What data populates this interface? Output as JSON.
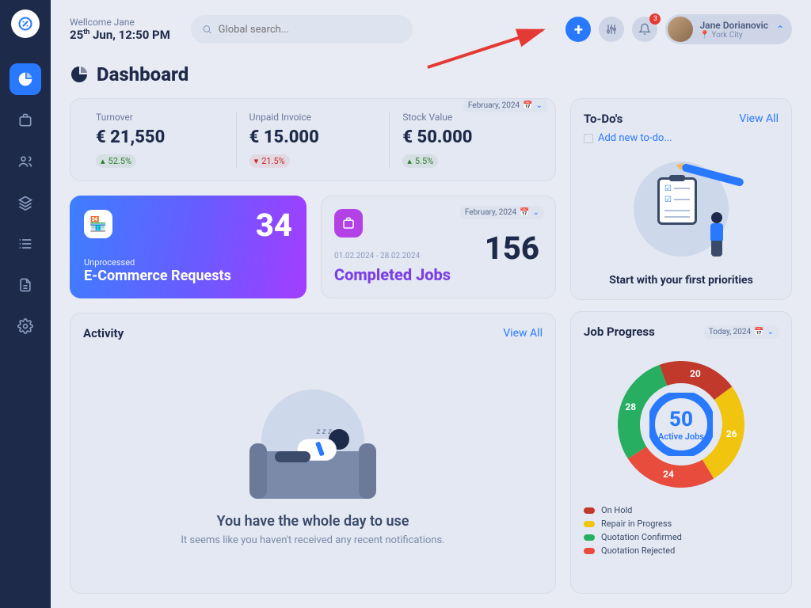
{
  "header": {
    "welcome_prefix": "Wellcome ",
    "welcome_name": "Jane",
    "date_day": "25",
    "date_suffix": "th",
    "date_rest": " Jun, 12:50 PM",
    "search_placeholder": "Global search...",
    "notif_count": "3",
    "user_name": "Jane Dorianovic",
    "user_location": "York City"
  },
  "page_title": "Dashboard",
  "stats": {
    "date_filter": "February, 2024",
    "turnover": {
      "label": "Turnover",
      "value": "€ 21,550",
      "delta": "52.5%",
      "dir": "up"
    },
    "unpaid": {
      "label": "Unpaid Invoice",
      "value": "€ 15.000",
      "delta": "21.5%",
      "dir": "down"
    },
    "stock": {
      "label": "Stock Value",
      "value": "€ 50.000",
      "delta": "5.5%",
      "dir": "up"
    }
  },
  "ecom": {
    "count": "34",
    "sub": "Unprocessed",
    "title": "E-Commerce Requests"
  },
  "jobs": {
    "date_filter": "February, 2024",
    "count": "156",
    "range": "01.02.2024 - 28.02.2024",
    "title": "Completed Jobs"
  },
  "activity": {
    "title": "Activity",
    "view_all": "View All",
    "empty_title": "You have the whole day to use",
    "empty_sub": "It seems like you haven't received any recent notifications."
  },
  "todos": {
    "title": "To-Do's",
    "view_all": "View All",
    "add_label": "Add new to-do...",
    "empty_title": "Start with your first priorities"
  },
  "progress": {
    "title": "Job Progress",
    "date_filter": "Today, 2024",
    "center_value": "50",
    "center_label": "Active Jobs",
    "legend": [
      {
        "label": "On Hold",
        "color": "#c0392b"
      },
      {
        "label": "Repair in Progress",
        "color": "#f1c40f"
      },
      {
        "label": "Quotation Confirmed",
        "color": "#27ae60"
      },
      {
        "label": "Quotation Rejected",
        "color": "#e74c3c"
      }
    ]
  },
  "chart_data": {
    "type": "pie",
    "title": "Job Progress",
    "series": [
      {
        "name": "On Hold",
        "value": 20,
        "color": "#c0392b"
      },
      {
        "name": "Repair in Progress",
        "value": 26,
        "color": "#f1c40f"
      },
      {
        "name": "Quotation Rejected",
        "value": 24,
        "color": "#e74c3c"
      },
      {
        "name": "Quotation Confirmed",
        "value": 28,
        "color": "#27ae60"
      }
    ],
    "center_value": 50,
    "center_label": "Active Jobs"
  }
}
